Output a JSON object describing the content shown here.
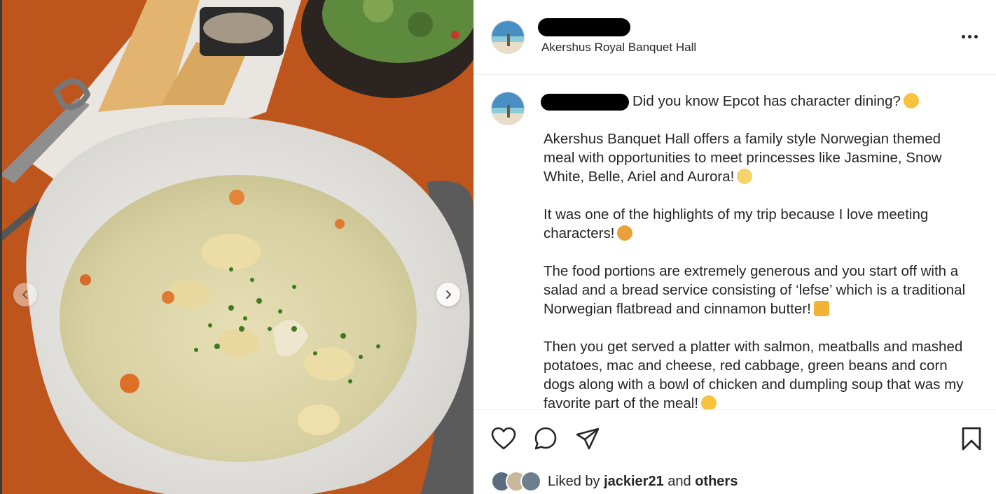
{
  "post": {
    "location": "Akershus Royal Banquet Hall",
    "caption": {
      "first_line": "Did you know Epcot has character dining?",
      "paragraphs": [
        "Akershus Banquet Hall offers a family style Norwegian themed meal with opportunities to meet princesses like Jasmine, Snow White, Belle, Ariel and Aurora!",
        "It was one of the highlights of my trip because I love meeting characters!",
        "The food portions are extremely generous and you start off with a salad and a bread service consisting of ‘lefse’ which is a traditional Norwegian flatbread and cinnamon butter!",
        "Then you get served a platter with salmon, meatballs and mashed potatoes, mac and cheese, red cabbage, green beans and corn dogs along with a bowl of chicken and dumpling soup that was my favorite part of the meal!"
      ]
    },
    "likes": {
      "prefix": "Liked by",
      "user": "jackier21",
      "conjunction": "and",
      "others": "others"
    }
  },
  "icons": {
    "carousel_prev": "chevron-left-icon",
    "carousel_next": "chevron-right-icon",
    "more": "more-options-icon",
    "like": "heart-icon",
    "comment": "comment-icon",
    "share": "share-icon",
    "save": "bookmark-icon"
  },
  "colors": {
    "text": "#262626",
    "divider": "#efefef",
    "background": "#ffffff"
  }
}
